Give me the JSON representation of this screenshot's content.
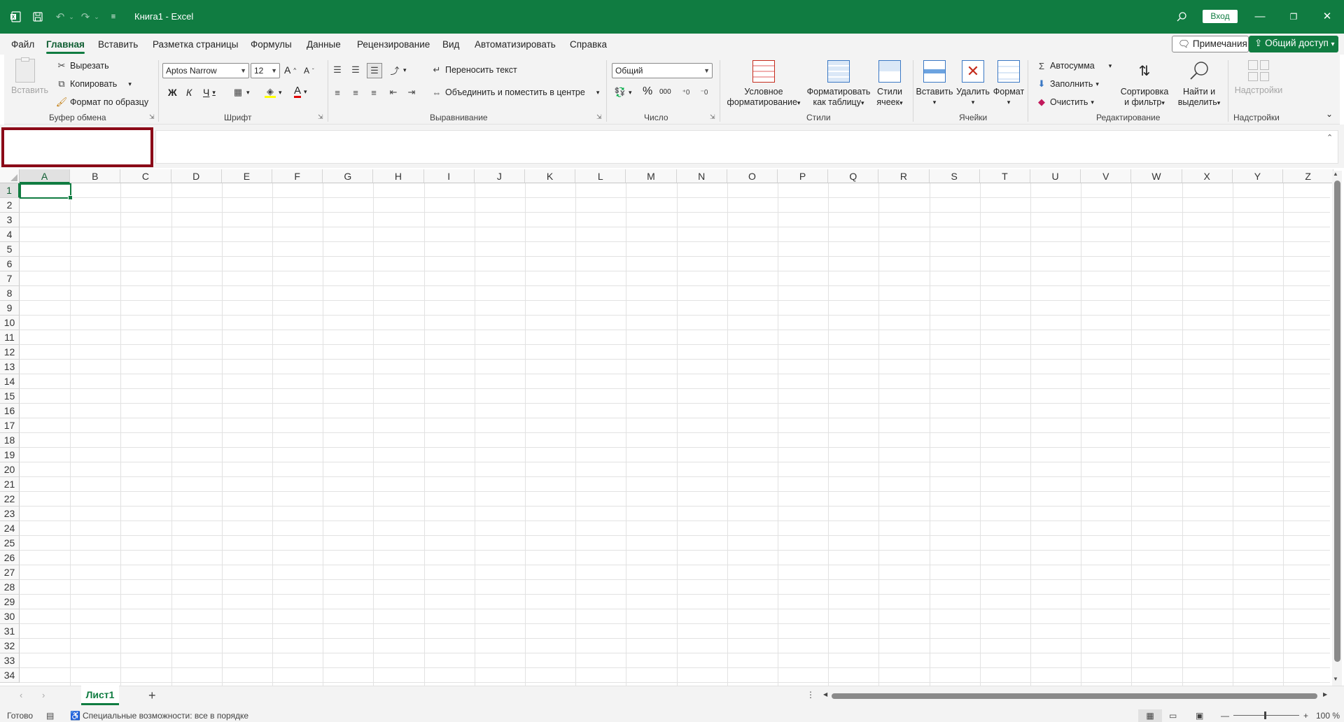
{
  "colors": {
    "brand": "#107c41",
    "namebox_highlight": "#8b0a18"
  },
  "titlebar": {
    "app_icon": "excel-logo-icon",
    "title": "Книга1  -  Excel",
    "login_label": "Вход"
  },
  "menu": {
    "tabs": [
      "Файл",
      "Главная",
      "Вставить",
      "Разметка страницы",
      "Формулы",
      "Данные",
      "Рецензирование",
      "Вид",
      "Автоматизировать",
      "Справка"
    ],
    "active_tab": "Главная",
    "notes_label": "Примечания",
    "share_label": "Общий доступ"
  },
  "ribbon": {
    "clipboard": {
      "label": "Буфер обмена",
      "paste": "Вставить",
      "cut": "Вырезать",
      "copy": "Копировать",
      "format_painter": "Формат по образцу"
    },
    "font": {
      "label": "Шрифт",
      "font_name": "Aptos Narrow",
      "font_size": "12",
      "bold": "Ж",
      "italic": "К",
      "underline": "Ч",
      "grow": "A",
      "shrink": "A",
      "font_color": "A"
    },
    "alignment": {
      "label": "Выравнивание",
      "wrap_text": "Переносить текст",
      "merge_center": "Объединить и поместить в центре"
    },
    "number": {
      "label": "Число",
      "format": "Общий",
      "percent": "%",
      "thousands": "000"
    },
    "styles": {
      "label": "Стили",
      "conditional_1": "Условное",
      "conditional_2": "форматирование",
      "format_table_1": "Форматировать",
      "format_table_2": "как таблицу",
      "cell_styles_1": "Стили",
      "cell_styles_2": "ячеек"
    },
    "cells": {
      "label": "Ячейки",
      "insert": "Вставить",
      "delete": "Удалить",
      "format": "Формат"
    },
    "editing": {
      "label": "Редактирование",
      "autosum": "Автосумма",
      "fill": "Заполнить",
      "clear": "Очистить",
      "sort_1": "Сортировка",
      "sort_2": "и фильтр",
      "find_1": "Найти и",
      "find_2": "выделить"
    },
    "addins": {
      "label": "Надстройки",
      "button": "Надстройки"
    }
  },
  "grid": {
    "columns": [
      "A",
      "B",
      "C",
      "D",
      "E",
      "F",
      "G",
      "H",
      "I",
      "J",
      "K",
      "L",
      "M",
      "N",
      "O",
      "P",
      "Q",
      "R",
      "S",
      "T",
      "U",
      "V",
      "W",
      "X",
      "Y",
      "Z"
    ],
    "rows": [
      "1",
      "2",
      "3",
      "4",
      "5",
      "6",
      "7",
      "8",
      "9",
      "10",
      "11",
      "12",
      "13",
      "14",
      "15",
      "16",
      "17",
      "18",
      "19",
      "20",
      "21",
      "22",
      "23",
      "24",
      "25",
      "26",
      "27",
      "28",
      "29",
      "30",
      "31",
      "32",
      "33",
      "34"
    ],
    "active_cell": "A1"
  },
  "sheets": {
    "tabs": [
      "Лист1"
    ],
    "add_icon": "+"
  },
  "status": {
    "ready": "Готово",
    "accessibility": "Специальные возможности: все в порядке",
    "zoom": "100 %"
  }
}
